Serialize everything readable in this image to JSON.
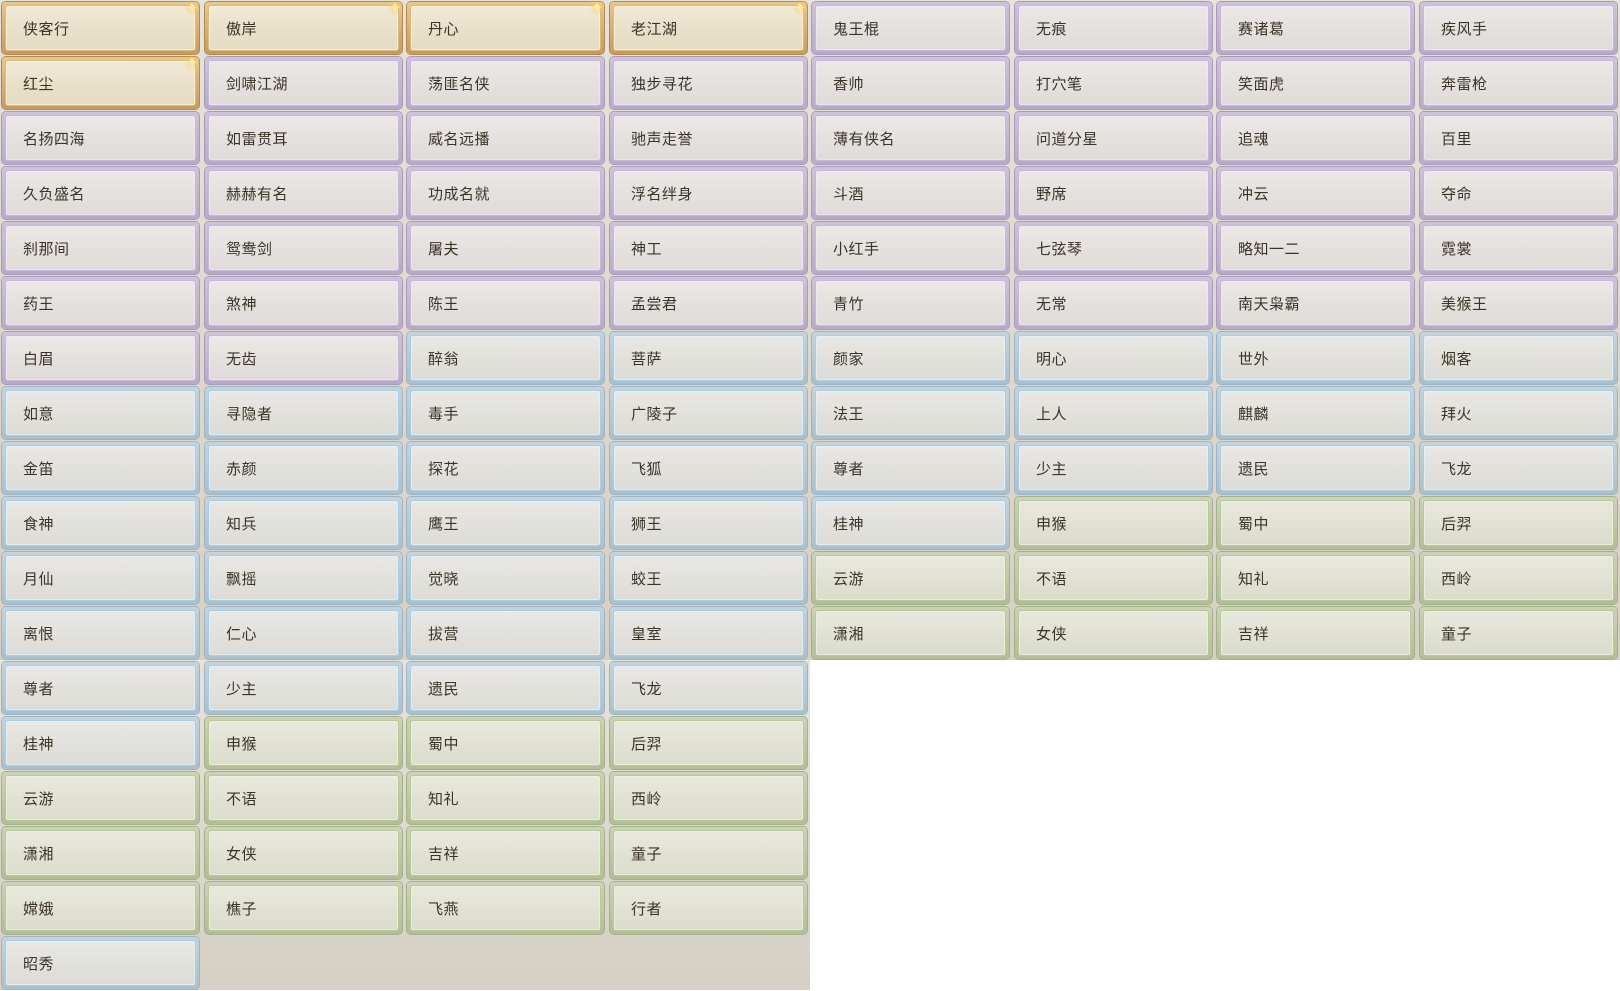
{
  "colors": {
    "gold": "#d7b985",
    "purple": "#c8b6db",
    "blue": "#a9cde2",
    "green": "#b6c99a",
    "text": "#3b3326"
  },
  "icons": {
    "new_marker": "sparkle-icon"
  },
  "titles": [
    {
      "label": "侠客行",
      "tier": "gold",
      "new": true
    },
    {
      "label": "傲岸",
      "tier": "gold",
      "new": true
    },
    {
      "label": "丹心",
      "tier": "gold",
      "new": true
    },
    {
      "label": "老江湖",
      "tier": "gold",
      "new": true
    },
    {
      "label": "鬼王棍",
      "tier": "purple"
    },
    {
      "label": "无痕",
      "tier": "purple"
    },
    {
      "label": "赛诸葛",
      "tier": "purple"
    },
    {
      "label": "疾风手",
      "tier": "purple"
    },
    {
      "label": "红尘",
      "tier": "gold",
      "new": true
    },
    {
      "label": "剑啸江湖",
      "tier": "purple"
    },
    {
      "label": "荡匪名侠",
      "tier": "purple"
    },
    {
      "label": "独步寻花",
      "tier": "purple"
    },
    {
      "label": "香帅",
      "tier": "purple"
    },
    {
      "label": "打穴笔",
      "tier": "purple"
    },
    {
      "label": "笑面虎",
      "tier": "purple"
    },
    {
      "label": "奔雷枪",
      "tier": "purple"
    },
    {
      "label": "名扬四海",
      "tier": "purple"
    },
    {
      "label": "如雷贯耳",
      "tier": "purple"
    },
    {
      "label": "威名远播",
      "tier": "purple"
    },
    {
      "label": "驰声走誉",
      "tier": "purple"
    },
    {
      "label": "薄有侠名",
      "tier": "purple"
    },
    {
      "label": "问道分星",
      "tier": "purple"
    },
    {
      "label": "追魂",
      "tier": "purple"
    },
    {
      "label": "百里",
      "tier": "purple"
    },
    {
      "label": "久负盛名",
      "tier": "purple"
    },
    {
      "label": "赫赫有名",
      "tier": "purple"
    },
    {
      "label": "功成名就",
      "tier": "purple"
    },
    {
      "label": "浮名绊身",
      "tier": "purple"
    },
    {
      "label": "斗酒",
      "tier": "purple"
    },
    {
      "label": "野席",
      "tier": "purple"
    },
    {
      "label": "冲云",
      "tier": "purple"
    },
    {
      "label": "夺命",
      "tier": "purple"
    },
    {
      "label": "刹那间",
      "tier": "purple"
    },
    {
      "label": "鸳鸯剑",
      "tier": "purple"
    },
    {
      "label": "屠夫",
      "tier": "purple"
    },
    {
      "label": "神工",
      "tier": "purple"
    },
    {
      "label": "小红手",
      "tier": "purple"
    },
    {
      "label": "七弦琴",
      "tier": "purple"
    },
    {
      "label": "略知一二",
      "tier": "purple"
    },
    {
      "label": "霓裳",
      "tier": "purple"
    },
    {
      "label": "药王",
      "tier": "purple"
    },
    {
      "label": "煞神",
      "tier": "purple"
    },
    {
      "label": "陈王",
      "tier": "purple"
    },
    {
      "label": "孟尝君",
      "tier": "purple"
    },
    {
      "label": "青竹",
      "tier": "purple"
    },
    {
      "label": "无常",
      "tier": "purple"
    },
    {
      "label": "南天枭霸",
      "tier": "purple"
    },
    {
      "label": "美猴王",
      "tier": "purple"
    },
    {
      "label": "白眉",
      "tier": "purple"
    },
    {
      "label": "无齿",
      "tier": "purple"
    },
    {
      "label": "醉翁",
      "tier": "blue"
    },
    {
      "label": "菩萨",
      "tier": "blue"
    },
    {
      "label": "颜家",
      "tier": "blue"
    },
    {
      "label": "明心",
      "tier": "blue"
    },
    {
      "label": "世外",
      "tier": "blue"
    },
    {
      "label": "烟客",
      "tier": "blue"
    },
    {
      "label": "如意",
      "tier": "blue"
    },
    {
      "label": "寻隐者",
      "tier": "blue"
    },
    {
      "label": "毒手",
      "tier": "blue"
    },
    {
      "label": "广陵子",
      "tier": "blue"
    },
    {
      "label": "法王",
      "tier": "blue"
    },
    {
      "label": "上人",
      "tier": "blue"
    },
    {
      "label": "麒麟",
      "tier": "blue"
    },
    {
      "label": "拜火",
      "tier": "blue"
    },
    {
      "label": "金笛",
      "tier": "blue"
    },
    {
      "label": "赤颜",
      "tier": "blue"
    },
    {
      "label": "探花",
      "tier": "blue"
    },
    {
      "label": "飞狐",
      "tier": "blue"
    },
    {
      "label": "尊者",
      "tier": "blue"
    },
    {
      "label": "少主",
      "tier": "blue"
    },
    {
      "label": "遗民",
      "tier": "blue"
    },
    {
      "label": "飞龙",
      "tier": "blue"
    },
    {
      "label": "食神",
      "tier": "blue"
    },
    {
      "label": "知兵",
      "tier": "blue"
    },
    {
      "label": "鹰王",
      "tier": "blue"
    },
    {
      "label": "狮王",
      "tier": "blue"
    },
    {
      "label": "桂神",
      "tier": "blue"
    },
    {
      "label": "申猴",
      "tier": "green"
    },
    {
      "label": "蜀中",
      "tier": "green"
    },
    {
      "label": "后羿",
      "tier": "green"
    },
    {
      "label": "月仙",
      "tier": "blue"
    },
    {
      "label": "飘摇",
      "tier": "blue"
    },
    {
      "label": "觉晓",
      "tier": "blue"
    },
    {
      "label": "蛟王",
      "tier": "blue"
    },
    {
      "label": "云游",
      "tier": "green"
    },
    {
      "label": "不语",
      "tier": "green"
    },
    {
      "label": "知礼",
      "tier": "green"
    },
    {
      "label": "西岭",
      "tier": "green"
    },
    {
      "label": "离恨",
      "tier": "blue"
    },
    {
      "label": "仁心",
      "tier": "blue"
    },
    {
      "label": "拔营",
      "tier": "blue"
    },
    {
      "label": "皇室",
      "tier": "blue"
    },
    {
      "label": "潇湘",
      "tier": "green"
    },
    {
      "label": "女侠",
      "tier": "green"
    },
    {
      "label": "吉祥",
      "tier": "green"
    },
    {
      "label": "童子",
      "tier": "green"
    },
    {
      "label": "尊者",
      "tier": "blue"
    },
    {
      "label": "少主",
      "tier": "blue"
    },
    {
      "label": "遗民",
      "tier": "blue"
    },
    {
      "label": "飞龙",
      "tier": "blue"
    },
    {
      "label": "桂神",
      "tier": "blue"
    },
    {
      "label": "申猴",
      "tier": "green"
    },
    {
      "label": "蜀中",
      "tier": "green"
    },
    {
      "label": "后羿",
      "tier": "green"
    },
    {
      "label": "云游",
      "tier": "green"
    },
    {
      "label": "不语",
      "tier": "green"
    },
    {
      "label": "知礼",
      "tier": "green"
    },
    {
      "label": "西岭",
      "tier": "green"
    },
    {
      "label": "潇湘",
      "tier": "green"
    },
    {
      "label": "女侠",
      "tier": "green"
    },
    {
      "label": "吉祥",
      "tier": "green"
    },
    {
      "label": "童子",
      "tier": "green"
    },
    {
      "label": "嫦娥",
      "tier": "green"
    },
    {
      "label": "樵子",
      "tier": "green"
    },
    {
      "label": "飞燕",
      "tier": "green"
    },
    {
      "label": "行者",
      "tier": "green"
    },
    {
      "label": "昭秀",
      "tier": "blue"
    }
  ]
}
